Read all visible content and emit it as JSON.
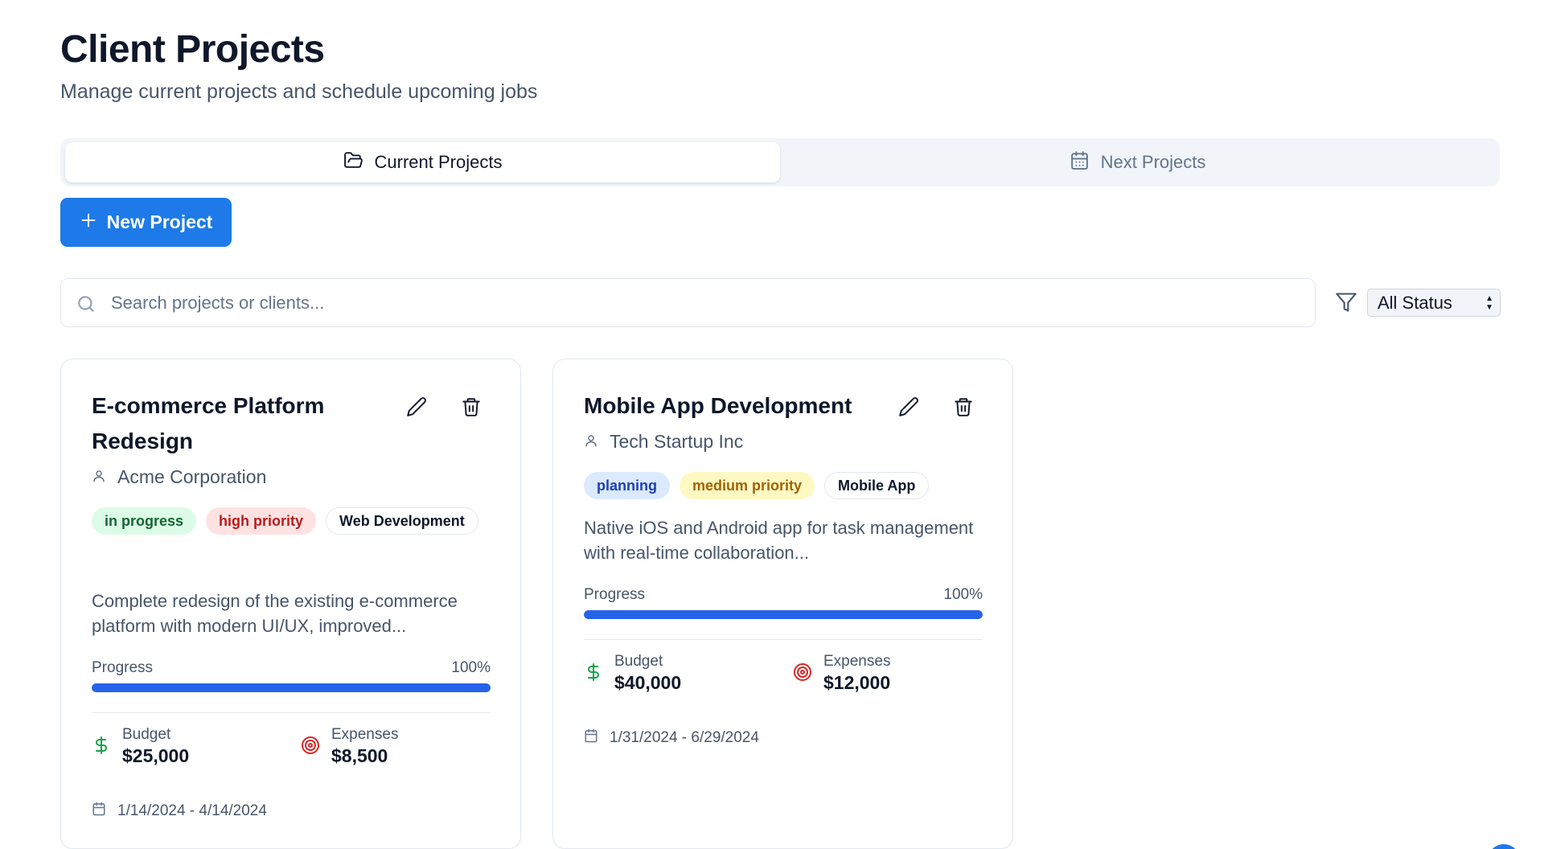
{
  "header": {
    "title": "Client Projects",
    "subtitle": "Manage current projects and schedule upcoming jobs"
  },
  "tabs": [
    {
      "label": "Current Projects",
      "icon": "folder-open-icon",
      "active": true
    },
    {
      "label": "Next Projects",
      "icon": "calendar-icon",
      "active": false
    }
  ],
  "toolbar": {
    "new_project_label": "New Project",
    "search_placeholder": "Search projects or clients...",
    "status_filter_value": "All Status"
  },
  "colors": {
    "primary": "#1d7ae8",
    "progress": "#2563eb",
    "budget_icon": "#16a34a",
    "expenses_icon": "#dc2626"
  },
  "projects": [
    {
      "title": "E-commerce Platform Redesign",
      "client": "Acme Corporation",
      "status": "in progress",
      "priority": "high priority",
      "category": "Web Development",
      "description": "Complete redesign of the existing e-commerce platform with modern UI/UX, improved...",
      "progress_label": "Progress",
      "progress_text": "100%",
      "progress_value": 100,
      "budget_label": "Budget",
      "budget": "$25,000",
      "expenses_label": "Expenses",
      "expenses": "$8,500",
      "dates": "1/14/2024 - 4/14/2024"
    },
    {
      "title": "Mobile App Development",
      "client": "Tech Startup Inc",
      "status": "planning",
      "priority": "medium priority",
      "category": "Mobile App",
      "description": "Native iOS and Android app for task management with real-time collaboration...",
      "progress_label": "Progress",
      "progress_text": "100%",
      "progress_value": 100,
      "budget_label": "Budget",
      "budget": "$40,000",
      "expenses_label": "Expenses",
      "expenses": "$12,000",
      "dates": "1/31/2024 - 6/29/2024"
    }
  ]
}
